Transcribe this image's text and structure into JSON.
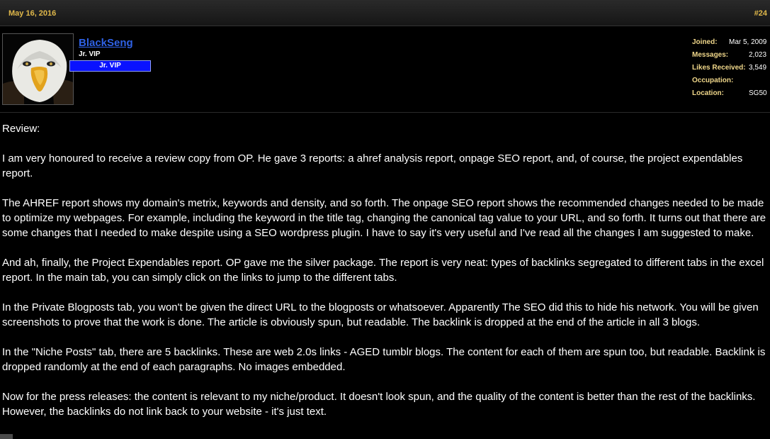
{
  "post": {
    "date": "May 16, 2016",
    "number": "#24"
  },
  "user": {
    "name": "BlackSeng",
    "title": "Jr. VIP",
    "badge": "Jr. VIP"
  },
  "stats": [
    {
      "label": "Joined:",
      "value": "Mar 5, 2009"
    },
    {
      "label": "Messages:",
      "value": "2,023"
    },
    {
      "label": "Likes Received:",
      "value": "3,549"
    },
    {
      "label": "Occupation:",
      "value": ""
    },
    {
      "label": "Location:",
      "value": "SG50"
    }
  ],
  "content": [
    "Review:",
    "I am very honoured to receive a review copy from OP. He gave 3 reports: a ahref analysis report, onpage SEO report, and, of course, the project expendables report.",
    "The AHREF report shows my domain's metrix, keywords and density, and so forth. The onpage SEO report shows the recommended changes needed to be made to optimize my webpages. For example, including the keyword in the title tag, changing the canonical tag value to your URL, and so forth. It turns out that there are some changes that I needed to make despite using a SEO wordpress plugin. I have to say it's very useful and I've read all the changes I am suggested to make.",
    "And ah, finally, the Project Expendables report. OP gave me the silver package. The report is very neat: types of backlinks segregated to different tabs in the excel report. In the main tab, you can simply click on the links to jump to the different tabs.",
    "In the Private Blogposts tab, you won't be given the direct URL to the blogposts or whatsoever. Apparently The SEO did this to hide his network. You will be given screenshots to prove that the work is done. The article is obviously spun, but readable. The backlink is dropped at the end of the article in all 3 blogs.",
    "In the \"Niche Posts\" tab, there are 5 backlinks. These are web 2.0s links - AGED tumblr blogs. The content for each of them are spun too, but readable. Backlink is dropped randomly at the end of each paragraphs. No images embedded.",
    "Now for the press releases: the content is relevant to my niche/product. It doesn't look spun, and the quality of the content is better than the rest of the backlinks. However, the backlinks do not link back to your website - it's just text."
  ],
  "colors": {
    "date": "#e0b84a",
    "username": "#2f62e6",
    "badge": "#0a12ff",
    "stat_label": "#f0d78a"
  },
  "icons": {
    "avatar": "bald-eagle-avatar"
  }
}
